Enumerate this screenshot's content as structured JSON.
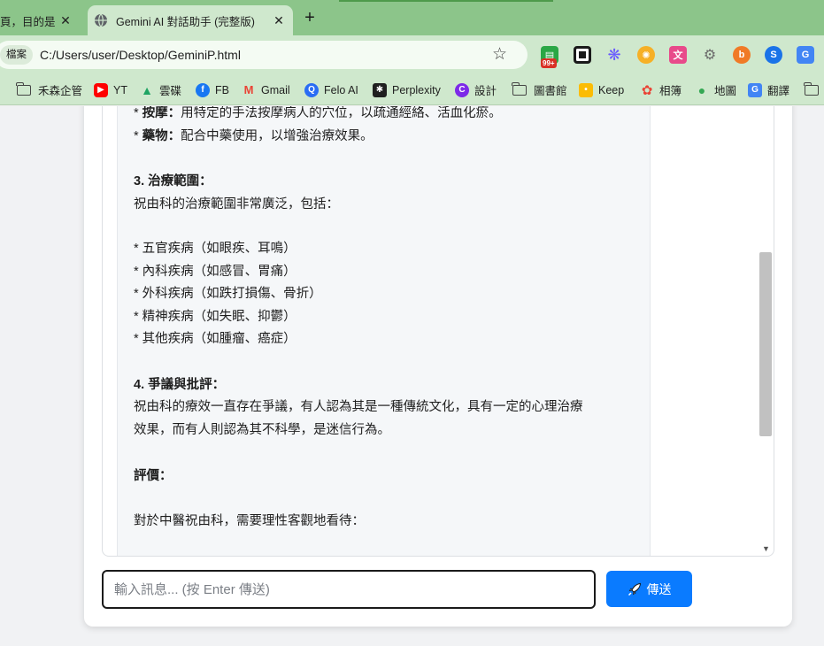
{
  "browser": {
    "tabs": [
      {
        "title": "頁，目的是"
      },
      {
        "title": "Gemini AI 對話助手 (完整版)"
      }
    ],
    "new_tab_label": "+",
    "close_glyph": "✕",
    "site_chip": "檔案",
    "url": "C:/Users/user/Desktop/GeminiP.html",
    "extension_badge": "99+",
    "bookmarks": [
      {
        "label": "禾森企管",
        "icon": "folder-icon"
      },
      {
        "label": "YT",
        "icon": "youtube-icon",
        "color": "#ff0000"
      },
      {
        "label": "雲碟",
        "icon": "google-drive-icon",
        "color": "#1fa463"
      },
      {
        "label": "FB",
        "icon": "facebook-icon",
        "color": "#1877f2"
      },
      {
        "label": "Gmail",
        "icon": "gmail-icon",
        "color": "#ea4335"
      },
      {
        "label": "Felo AI",
        "icon": "felo-icon",
        "color": "#2a6df4"
      },
      {
        "label": "Perplexity",
        "icon": "perplexity-icon",
        "color": "#1f1f1f"
      },
      {
        "label": "設計",
        "icon": "canva-icon",
        "color": "#7d2ae8"
      },
      {
        "label": "圖書館",
        "icon": "folder-icon"
      },
      {
        "label": "Keep",
        "icon": "keep-icon",
        "color": "#fbbc04"
      },
      {
        "label": "相簿",
        "icon": "photos-icon",
        "color": "#ea4335"
      },
      {
        "label": "地圖",
        "icon": "maps-icon",
        "color": "#34a853"
      },
      {
        "label": "翻譯",
        "icon": "translate-icon",
        "color": "#4285f4"
      },
      {
        "label": "",
        "icon": "folder-icon"
      }
    ]
  },
  "chat": {
    "lines": [
      {
        "label": "按摩：",
        "text": "用特定的手法按摩病人的穴位，以疏通經絡、活血化瘀。",
        "prefix": "* "
      },
      {
        "label": "藥物：",
        "text": "配合中藥使用，以增強治療效果。",
        "prefix": "* "
      },
      {
        "label": "3. 治療範圍：",
        "text": "",
        "prefix": ""
      },
      {
        "label": "",
        "text": "祝由科的治療範圍非常廣泛，包括：",
        "prefix": ""
      },
      {
        "label": "",
        "text": "五官疾病（如眼疾、耳鳴）",
        "prefix": "* "
      },
      {
        "label": "",
        "text": "內科疾病（如感冒、胃痛）",
        "prefix": "* "
      },
      {
        "label": "",
        "text": "外科疾病（如跌打損傷、骨折）",
        "prefix": "* "
      },
      {
        "label": "",
        "text": "精神疾病（如失眠、抑鬱）",
        "prefix": "* "
      },
      {
        "label": "",
        "text": "其他疾病（如腫瘤、癌症）",
        "prefix": "* "
      },
      {
        "label": "4. 爭議與批評：",
        "text": "",
        "prefix": ""
      },
      {
        "label": "",
        "text": "祝由科的療效一直存在爭議，有人認為其是一種傳統文化，具有一定的心理治療",
        "prefix": ""
      },
      {
        "label": "",
        "text": "效果，而有人則認為其不科學，是迷信行為。",
        "prefix": ""
      },
      {
        "label": "評價：",
        "text": "",
        "prefix": ""
      },
      {
        "label": "",
        "text": "對於中醫祝由科，需要理性客觀地看待：",
        "prefix": ""
      }
    ],
    "input_placeholder": "輸入訊息... (按 Enter 傳送)",
    "send_label": "傳送"
  },
  "colors": {
    "tab_strip": "#8cc58a",
    "toolbar": "#cfe8cd",
    "send_button": "#0a7bff"
  }
}
